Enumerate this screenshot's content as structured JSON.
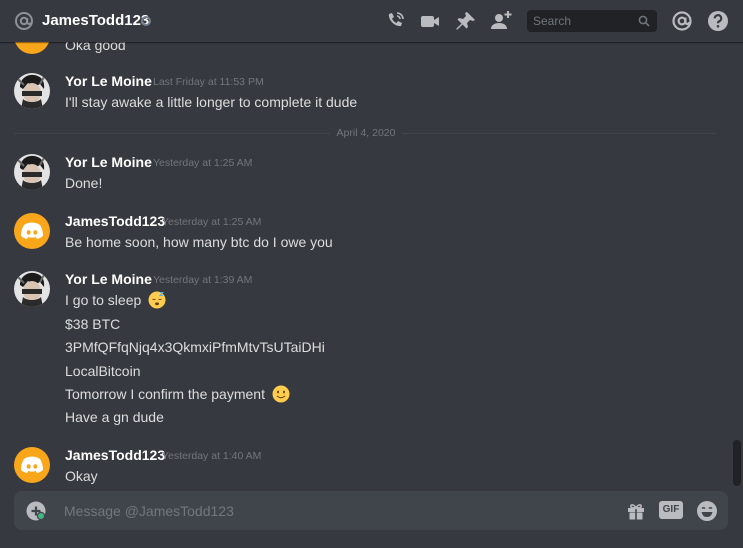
{
  "header": {
    "channel_name": "JamesTodd123",
    "search_placeholder": "Search",
    "icons": [
      "at-icon",
      "status-dot",
      "call-icon",
      "video-icon",
      "pin-icon",
      "add-friend-icon",
      "search-icon",
      "mention-icon",
      "help-icon"
    ]
  },
  "divider": {
    "label": "April 4, 2020"
  },
  "messages": [
    {
      "author": "",
      "timestamp": "",
      "lines": [
        "Oka good"
      ]
    },
    {
      "author": "Yor Le Moine",
      "timestamp": "Last Friday at 11:53 PM",
      "lines": [
        "I'll stay awake a little longer to complete it dude"
      ]
    },
    {
      "author": "Yor Le Moine",
      "timestamp": "Yesterday at 1:25 AM",
      "lines": [
        "Done!"
      ]
    },
    {
      "author": "JamesTodd123",
      "timestamp": "Yesterday at 1:25 AM",
      "lines": [
        "Be home soon, how many btc do I owe you"
      ]
    },
    {
      "author": "Yor Le Moine",
      "timestamp": "Yesterday at 1:39 AM",
      "lines": [
        "I go to sleep",
        "$38 BTC",
        "3PMfQFfqNjq4x3QkmxiPfmMtvTsUTaiDHi",
        "LocalBitcoin",
        "Tomorrow I confirm the payment",
        "Have a gn dude"
      ]
    },
    {
      "author": "JamesTodd123",
      "timestamp": "Yesterday at 1:40 AM",
      "lines": [
        "Okay"
      ]
    }
  ],
  "emojis": {
    "sleep": "sleeping-face-emoji",
    "smile": "slightly-smiling-face-emoji"
  },
  "composer": {
    "placeholder": "Message @JamesTodd123",
    "icons": [
      "add-attachment-icon",
      "gift-icon",
      "gif-icon",
      "emoji-picker-icon"
    ],
    "gif_label": "GIF"
  },
  "colors": {
    "background": "#36393f",
    "header_text": "#ffffff",
    "message_text": "#dcddde",
    "timestamp": "#72767d",
    "discord_avatar": "#faa61a",
    "composer_bg": "#40444b",
    "search_bg": "#202225"
  }
}
